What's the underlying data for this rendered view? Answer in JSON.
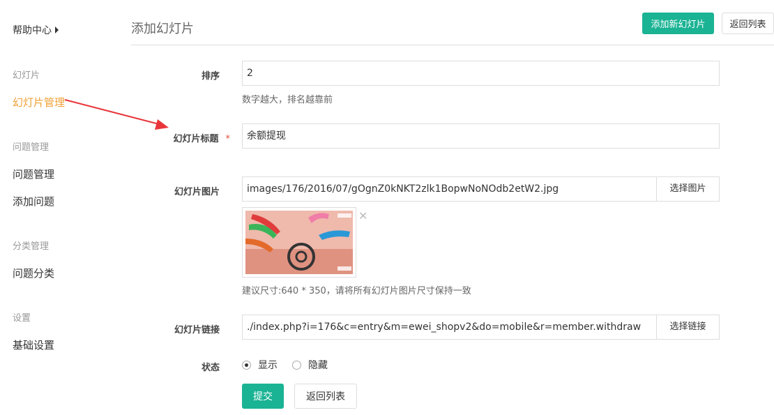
{
  "sidebar": {
    "header": "帮助中心",
    "groups": [
      {
        "title": "幻灯片",
        "items": [
          "幻灯片管理"
        ]
      },
      {
        "title": "问题管理",
        "items": [
          "问题管理",
          "添加问题"
        ]
      },
      {
        "title": "分类管理",
        "items": [
          "问题分类"
        ]
      },
      {
        "title": "设置",
        "items": [
          "基础设置"
        ]
      }
    ]
  },
  "header": {
    "title": "添加幻灯片",
    "add_button": "添加新幻灯片",
    "back_button": "返回列表"
  },
  "form": {
    "order": {
      "label": "排序",
      "value": "2",
      "help": "数字越大，排名越靠前"
    },
    "title": {
      "label": "幻灯片标题",
      "required_mark": "*",
      "value": "余额提现"
    },
    "image": {
      "label": "幻灯片图片",
      "value": "images/176/2016/07/gOgnZ0kNKT2zlk1BopwNoNOdb2etW2.jpg",
      "choose_button": "选择图片",
      "remove_icon": "✕",
      "help": "建议尺寸:640 * 350，请将所有幻灯片图片尺寸保持一致"
    },
    "link": {
      "label": "幻灯片链接",
      "value": "./index.php?i=176&c=entry&m=ewei_shopv2&do=mobile&r=member.withdraw",
      "choose_button": "选择链接"
    },
    "status": {
      "label": "状态",
      "options": [
        "显示",
        "隐藏"
      ],
      "selected": "显示"
    },
    "submit_button": "提交",
    "back_button": "返回列表"
  },
  "colors": {
    "primary": "#1ab394",
    "active_menu": "#f0a035",
    "annotation_arrow": "#e8363a",
    "required": "#e74c3c"
  }
}
